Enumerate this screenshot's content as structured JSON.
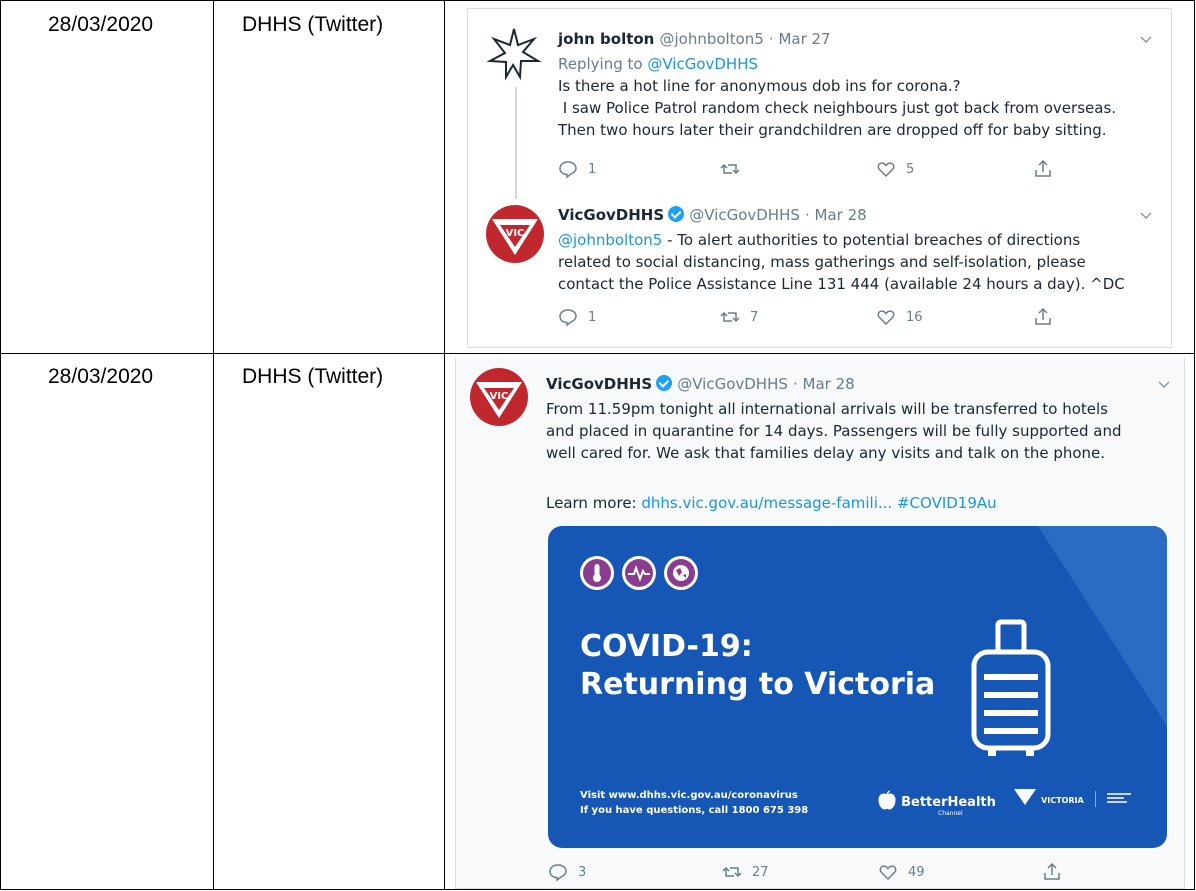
{
  "rows": [
    {
      "date": "28/03/2020",
      "source": "DHHS (Twitter)",
      "reply_tweet": {
        "name": "john bolton",
        "handle": "@johnbolton5",
        "time": "· Mar 27",
        "replying_to_prefix": "Replying to",
        "replying_to": "@VicGovDHHS",
        "lines": [
          "Is there a hot line for anonymous dob ins for corona.?",
          " I saw Police Patrol random check neighbours just got back from overseas.",
          "Then two hours later their grandchildren are dropped off for baby sitting."
        ],
        "replies": "1",
        "retweets": "",
        "likes": "5"
      },
      "response_tweet": {
        "name": "VicGovDHHS",
        "handle": "@VicGovDHHS",
        "time": "· Mar 28",
        "mention": "@johnbolton5",
        "lines": [
          " - To alert authorities to potential breaches of directions",
          "related to social distancing, mass gatherings and self-isolation, please",
          "contact the Police Assistance Line 131 444 (available 24 hours a day). ^DC"
        ],
        "replies": "1",
        "retweets": "7",
        "likes": "16"
      }
    },
    {
      "date": "28/03/2020",
      "source": "DHHS (Twitter)",
      "tweet": {
        "name": "VicGovDHHS",
        "handle": "@VicGovDHHS",
        "time": "· Mar 28",
        "lines": [
          "From 11.59pm tonight all international arrivals will be transferred to hotels",
          "and placed in quarantine for 14 days. Passengers will be fully supported and",
          "well cared for. We ask that families delay any visits and talk on the phone."
        ],
        "learn_more": "Learn more: ",
        "link": "dhhs.vic.gov.au/message-famili...",
        "hashtag": "#COVID19Au",
        "card": {
          "title_line1": "COVID-19:",
          "title_line2": "Returning to Victoria",
          "footer_line1": "Visit www.dhhs.vic.gov.au/coronavirus",
          "footer_line2": "If you have questions, call 1800 675 398",
          "brand": "BetterHealth",
          "brand_sub": "Channel",
          "vic_logo": "VICTORIA"
        },
        "replies": "3",
        "retweets": "27",
        "likes": "49"
      }
    }
  ],
  "avatar_vic_text": "VIC",
  "colors": {
    "link": "#1b95e0",
    "card_blue": "#1657b5",
    "vic_red": "#c0282e",
    "verified": "#1da1f2"
  }
}
